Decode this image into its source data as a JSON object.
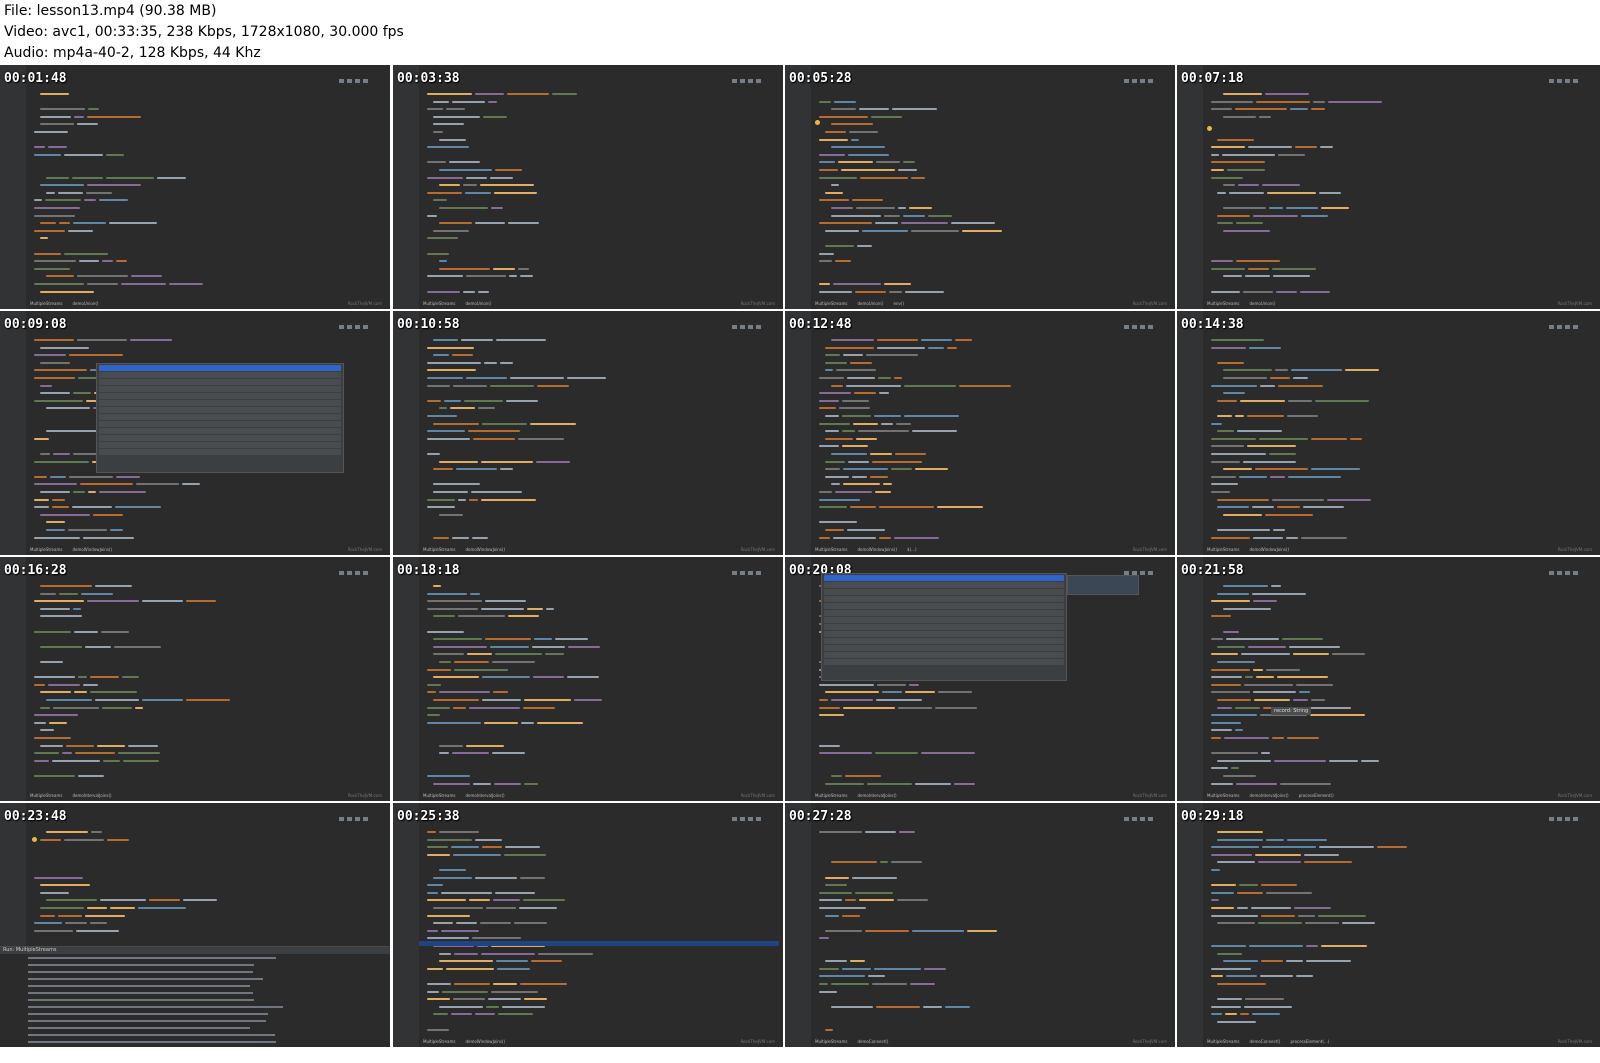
{
  "file_info": {
    "line1": "File: lesson13.mp4 (90.38 MB)",
    "line2": "Video: avc1, 00:33:35, 238 Kbps, 1728x1080, 30.000 fps",
    "line3": "Audio: mp4a-40-2, 128 Kbps, 44 Khz"
  },
  "thumbnails": [
    {
      "timestamp": "00:01:48",
      "breadcrumb": [
        "MultipleStreams",
        "demoUnion()"
      ]
    },
    {
      "timestamp": "00:03:38",
      "breadcrumb": [
        "MultipleStreams",
        "demoUnion()"
      ]
    },
    {
      "timestamp": "00:05:28",
      "breadcrumb": [
        "MultipleStreams",
        "demoUnion()",
        "env()"
      ]
    },
    {
      "timestamp": "00:07:18",
      "breadcrumb": [
        "MultipleStreams",
        "demoUnion()"
      ]
    },
    {
      "timestamp": "00:09:08",
      "breadcrumb": [
        "MultipleStreams",
        "demoWindowJoins()"
      ]
    },
    {
      "timestamp": "00:10:58",
      "breadcrumb": [
        "MultipleStreams",
        "demoWindowJoins()"
      ]
    },
    {
      "timestamp": "00:12:48",
      "breadcrumb": [
        "MultipleStreams",
        "demoWindowJoins()",
        "$(...)"
      ]
    },
    {
      "timestamp": "00:14:38",
      "breadcrumb": [
        "MultipleStreams",
        "demoWindowJoins()"
      ]
    },
    {
      "timestamp": "00:16:28",
      "breadcrumb": [
        "MultipleStreams",
        "demoIntervalJoins()"
      ]
    },
    {
      "timestamp": "00:18:18",
      "breadcrumb": [
        "MultipleStreams",
        "demoIntervalJoins()"
      ]
    },
    {
      "timestamp": "00:20:08",
      "breadcrumb": [
        "MultipleStreams",
        "demoIntervalJoins()"
      ]
    },
    {
      "timestamp": "00:21:58",
      "breadcrumb": [
        "MultipleStreams",
        "demoIntervalJoins()",
        "processElement()"
      ]
    },
    {
      "timestamp": "00:23:48",
      "breadcrumb": [
        "MultipleStreams",
        "demoIntervalJoins()"
      ]
    },
    {
      "timestamp": "00:25:38",
      "breadcrumb": [
        "MultipleStreams",
        "demoWindowJoins()"
      ]
    },
    {
      "timestamp": "00:27:28",
      "breadcrumb": [
        "MultipleStreams",
        "demoConnect()"
      ]
    },
    {
      "timestamp": "00:29:18",
      "breadcrumb": [
        "MultipleStreams",
        "demoConnect()",
        "processElement(...)"
      ]
    }
  ],
  "run_panel": {
    "label": "Run: MultipleStreams"
  },
  "popup_tooltip": {
    "text": "record: String"
  },
  "watermark": "RockTheJVM.com",
  "colors": {
    "editor_bg": "#2b2b2b",
    "gutter_bg": "#313335",
    "keyword": "#cc7832",
    "identifier": "#a9b7c6",
    "string": "#6a8759",
    "function": "#ffc66d",
    "comment": "#808080",
    "number": "#6897bb",
    "selection": "#214283",
    "popup_selected": "#2f65ca"
  }
}
